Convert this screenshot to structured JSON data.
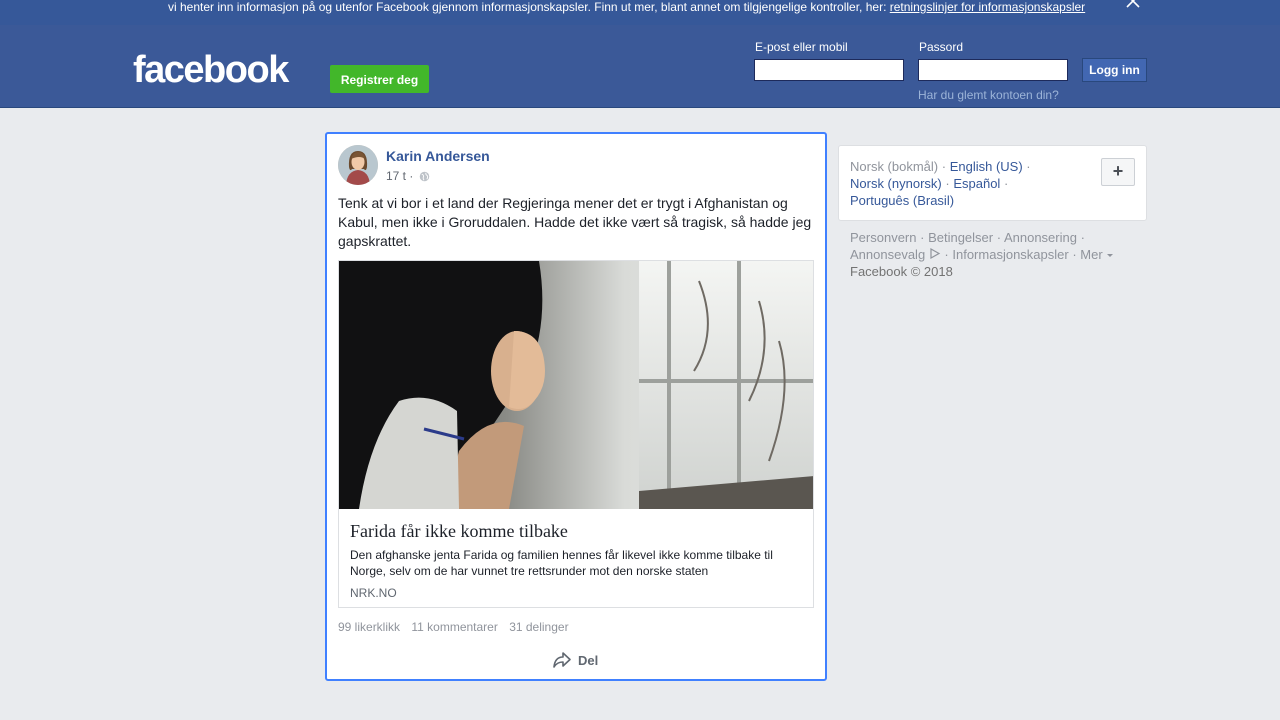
{
  "cookie_banner": {
    "text": "vi henter inn informasjon på og utenfor Facebook gjennom informasjonskapsler. Finn ut mer, blant annet om tilgjengelige kontroller, her:",
    "link": "retningslinjer for informasjonskapsler"
  },
  "header": {
    "logo": "facebook",
    "register_label": "Registrer deg",
    "email_label": "E-post eller mobil",
    "password_label": "Passord",
    "login_label": "Logg inn",
    "forgot_label": "Har du glemt kontoen din?"
  },
  "post": {
    "author": "Karin Andersen",
    "time": "17 t ·",
    "text": "Tenk at vi bor i et land der Regjeringa mener det er trygt i Afghanistan og Kabul, men ikke i Groruddalen. Hadde det ikke vært så tragisk, så hadde jeg gapskrattet.",
    "link": {
      "title": "Farida får ikke komme tilbake",
      "description": "Den afghanske jenta Farida og familien hennes får likevel ikke komme tilbake til Norge, selv om de har vunnet tre rettsrunder mot den norske staten",
      "source": "NRK.NO"
    },
    "likes": "99 likerklikk",
    "comments": "11 kommentarer",
    "shares": "31 delinger",
    "share_label": "Del"
  },
  "sidebar": {
    "languages": [
      "Norsk (bokmål)",
      "English (US)",
      "Norsk (nynorsk)",
      "Español",
      "Português (Brasil)"
    ],
    "add_language": "+",
    "footer_links": [
      "Personvern",
      "Betingelser",
      "Annonsering",
      "Annonsevalg",
      "Informasjonskapsler",
      "Mer"
    ],
    "copyright": "Facebook © 2018"
  },
  "colors": {
    "brand": "#3b5998",
    "link": "#365899",
    "register_green": "#42b72a",
    "focus_border": "#4080ff"
  }
}
